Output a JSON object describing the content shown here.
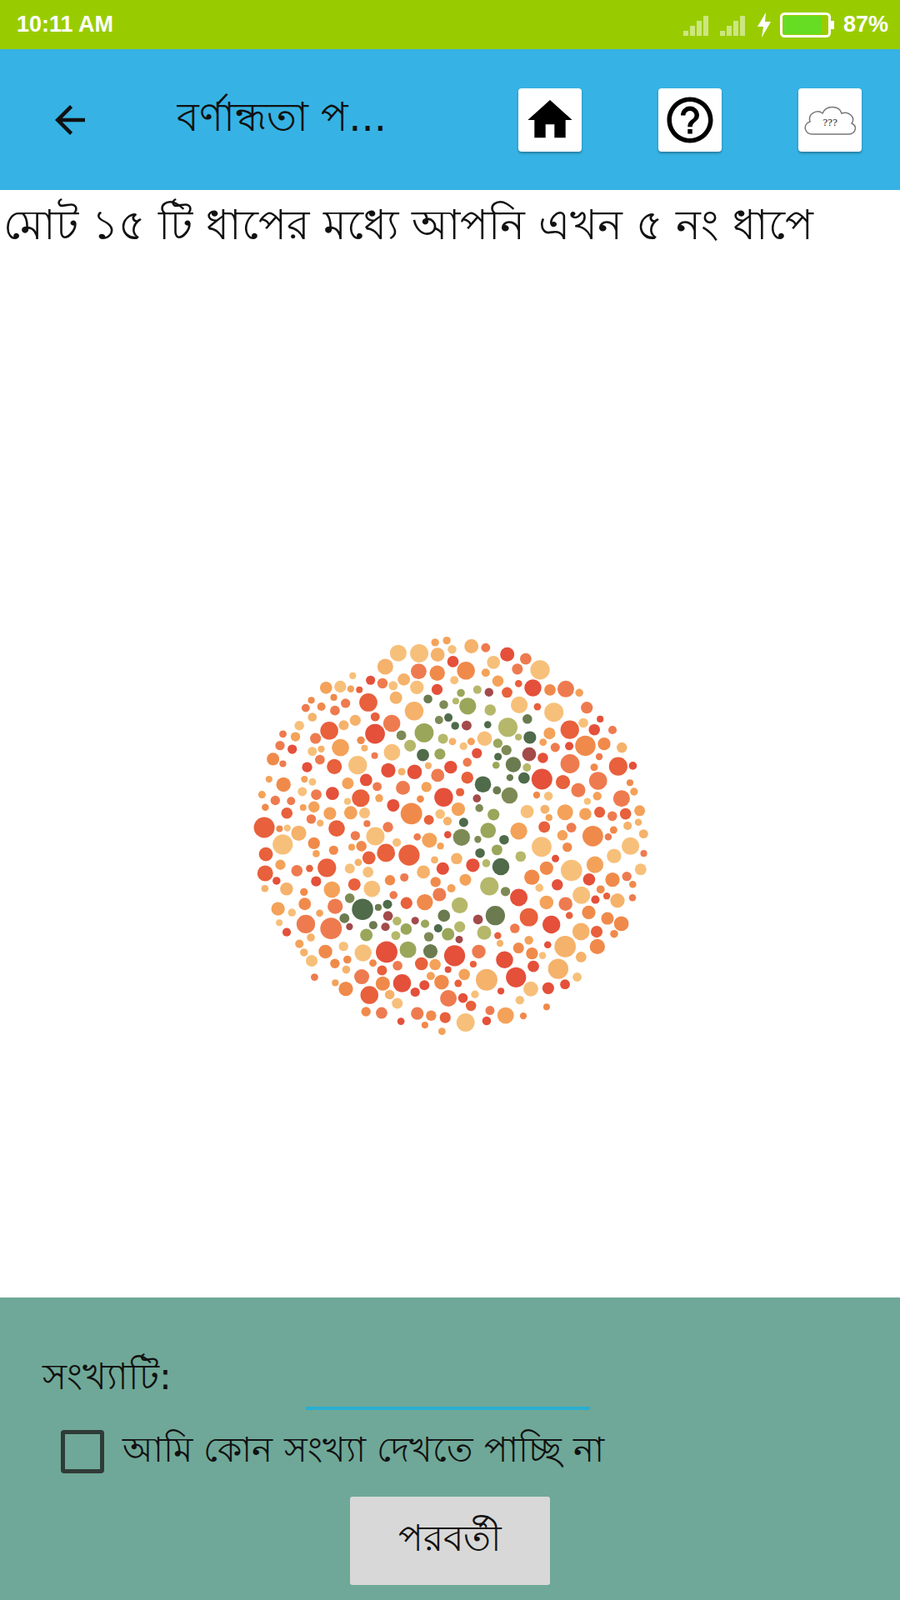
{
  "status_bar": {
    "time": "10:11 AM",
    "battery": "87%",
    "battery_level": 0.87,
    "charging": true,
    "signals": [
      {
        "level": 0
      },
      {
        "level": 0
      }
    ]
  },
  "app_bar": {
    "title": "বর্ণান্ধতা প...",
    "cloud_label": "???"
  },
  "progress_text": "মোট ১৫ টি ধাপের মধ্যে আপনি এখন ৫ নং ধাপে",
  "answer": {
    "label": "সংখ্যাটি:",
    "value": ""
  },
  "cant_see": {
    "label": "আমি কোন সংখ্যা দেখতে পাচ্ছি না",
    "checked": false
  },
  "buttons": [
    "পরবর্তী"
  ]
}
